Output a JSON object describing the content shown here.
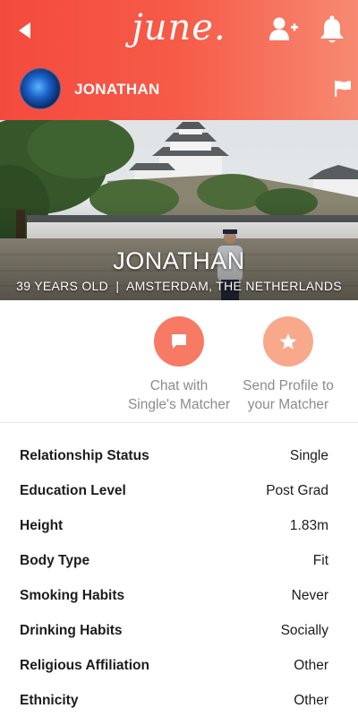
{
  "header": {
    "logo_text": "june.",
    "profile_name": "JONATHAN",
    "colors": {
      "gradient_start": "#f44a3e",
      "gradient_end": "#f78a72"
    },
    "icons": {
      "back": "back-arrow-icon",
      "add_user": "add-user-icon",
      "notifications": "bell-icon",
      "report": "flag-icon"
    }
  },
  "hero": {
    "name": "JONATHAN",
    "subtitle": "39 YEARS OLD  |  AMSTERDAM, THE NETHERLANDS"
  },
  "actions": {
    "chat": {
      "line1": "Chat with",
      "line2": "Single's Matcher",
      "icon": "chat-bubble-icon",
      "color": "#f67a64"
    },
    "send": {
      "line1": "Send Profile to",
      "line2": "your Matcher",
      "icon": "star-icon",
      "color": "#f8a98c"
    }
  },
  "details": [
    {
      "label": "Relationship Status",
      "value": "Single"
    },
    {
      "label": "Education Level",
      "value": "Post Grad"
    },
    {
      "label": "Height",
      "value": "1.83m"
    },
    {
      "label": "Body Type",
      "value": "Fit"
    },
    {
      "label": "Smoking Habits",
      "value": "Never"
    },
    {
      "label": "Drinking Habits",
      "value": "Socially"
    },
    {
      "label": "Religious Affiliation",
      "value": "Other"
    },
    {
      "label": "Ethnicity",
      "value": "Other"
    }
  ]
}
